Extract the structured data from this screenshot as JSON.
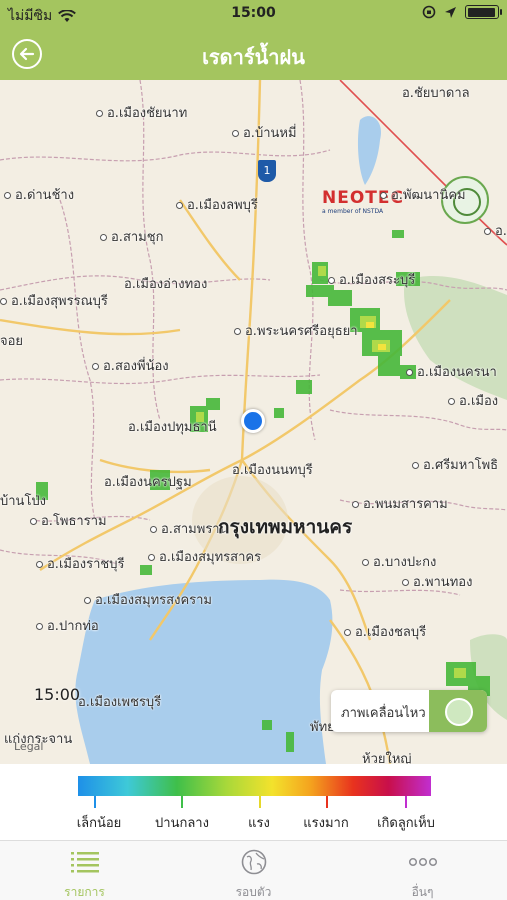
{
  "status_bar": {
    "carrier": "ไม่มีซิม",
    "time": "15:00",
    "battery_level": 0.95
  },
  "nav": {
    "title": "เรดาร์น้ำฝน",
    "back_icon": "circle-arrow-left-icon"
  },
  "map": {
    "time_label": "15:00",
    "legal": "Legal",
    "highway_number": "1",
    "logo_text": "NEOTEC",
    "logo_subtext": "a member of NSTDA",
    "places": [
      "อ.ชัยบาดาล",
      "อ.เมืองชัยนาท",
      "อ.บ้านหมี่",
      "อ.ด่านช้าง",
      "อ.เมืองลพบุรี",
      "อ.พัฒนานิคม",
      "อ.สามชุก",
      "อ.ปา",
      "อ.เมืองอ่างทอง",
      "อ.เมืองสระบุรี",
      "อ.เมืองสุพรรณบุรี",
      "อ.พระนครศรีอยุธยา",
      "อ.สองพี่น้อง",
      "อ.เมืองนครนา",
      "อ.เมืองปทุมธานี",
      "อ.เมือง",
      "อ.เมืองนนทบุรี",
      "อ.ศรีมหาโพธิ",
      "อ.เมืองนครปฐม",
      "อ.พนมสารคาม",
      "บ้านโป่ง",
      "อ.โพธาราม",
      "อ.สามพราน",
      "กรุงเทพมหานคร",
      "อ.เมืองสมุทรสาคร",
      "อ.บางปะกง",
      "อ.เมืองราชบุรี",
      "อ.พานทอง",
      "อ.เมืองสมุทรสงคราม",
      "อ.ปากท่อ",
      "อ.เมืองชลบุรี",
      "อ.เมืองเพชรบุรี",
      "พัทยา",
      "แก่งกระจาน",
      "ห้วยใหญ่",
      "จอย"
    ]
  },
  "animation_button": {
    "label": "ภาพเคลื่อนไหว"
  },
  "legend": {
    "labels": [
      "เล็กน้อย",
      "ปานกลาง",
      "แรง",
      "แรงมาก",
      "เกิดลูกเห็บ"
    ],
    "tick_colors": [
      "#1e90e8",
      "#3fbf4a",
      "#e6d82a",
      "#e8321e",
      "#c12ed0"
    ]
  },
  "tabs": [
    {
      "label": "รายการ",
      "icon": "list-icon",
      "active": true
    },
    {
      "label": "รอบตัว",
      "icon": "globe-icon",
      "active": false
    },
    {
      "label": "อื่นๆ",
      "icon": "more-dots-icon",
      "active": false
    }
  ]
}
